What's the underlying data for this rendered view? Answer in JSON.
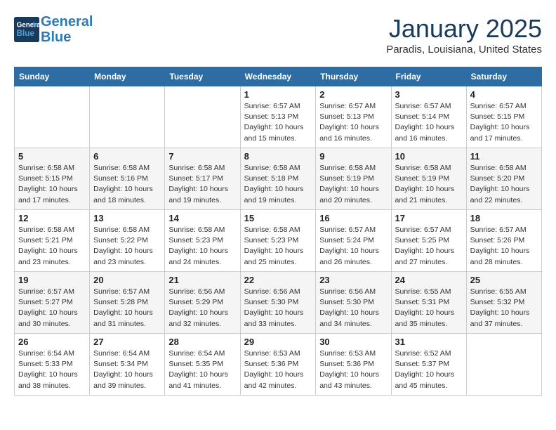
{
  "header": {
    "logo_line1": "General",
    "logo_line2": "Blue",
    "month": "January 2025",
    "location": "Paradis, Louisiana, United States"
  },
  "days_of_week": [
    "Sunday",
    "Monday",
    "Tuesday",
    "Wednesday",
    "Thursday",
    "Friday",
    "Saturday"
  ],
  "weeks": [
    [
      {
        "day": "",
        "detail": ""
      },
      {
        "day": "",
        "detail": ""
      },
      {
        "day": "",
        "detail": ""
      },
      {
        "day": "1",
        "detail": "Sunrise: 6:57 AM\nSunset: 5:13 PM\nDaylight: 10 hours\nand 15 minutes."
      },
      {
        "day": "2",
        "detail": "Sunrise: 6:57 AM\nSunset: 5:13 PM\nDaylight: 10 hours\nand 16 minutes."
      },
      {
        "day": "3",
        "detail": "Sunrise: 6:57 AM\nSunset: 5:14 PM\nDaylight: 10 hours\nand 16 minutes."
      },
      {
        "day": "4",
        "detail": "Sunrise: 6:57 AM\nSunset: 5:15 PM\nDaylight: 10 hours\nand 17 minutes."
      }
    ],
    [
      {
        "day": "5",
        "detail": "Sunrise: 6:58 AM\nSunset: 5:15 PM\nDaylight: 10 hours\nand 17 minutes."
      },
      {
        "day": "6",
        "detail": "Sunrise: 6:58 AM\nSunset: 5:16 PM\nDaylight: 10 hours\nand 18 minutes."
      },
      {
        "day": "7",
        "detail": "Sunrise: 6:58 AM\nSunset: 5:17 PM\nDaylight: 10 hours\nand 19 minutes."
      },
      {
        "day": "8",
        "detail": "Sunrise: 6:58 AM\nSunset: 5:18 PM\nDaylight: 10 hours\nand 19 minutes."
      },
      {
        "day": "9",
        "detail": "Sunrise: 6:58 AM\nSunset: 5:19 PM\nDaylight: 10 hours\nand 20 minutes."
      },
      {
        "day": "10",
        "detail": "Sunrise: 6:58 AM\nSunset: 5:19 PM\nDaylight: 10 hours\nand 21 minutes."
      },
      {
        "day": "11",
        "detail": "Sunrise: 6:58 AM\nSunset: 5:20 PM\nDaylight: 10 hours\nand 22 minutes."
      }
    ],
    [
      {
        "day": "12",
        "detail": "Sunrise: 6:58 AM\nSunset: 5:21 PM\nDaylight: 10 hours\nand 23 minutes."
      },
      {
        "day": "13",
        "detail": "Sunrise: 6:58 AM\nSunset: 5:22 PM\nDaylight: 10 hours\nand 23 minutes."
      },
      {
        "day": "14",
        "detail": "Sunrise: 6:58 AM\nSunset: 5:23 PM\nDaylight: 10 hours\nand 24 minutes."
      },
      {
        "day": "15",
        "detail": "Sunrise: 6:58 AM\nSunset: 5:23 PM\nDaylight: 10 hours\nand 25 minutes."
      },
      {
        "day": "16",
        "detail": "Sunrise: 6:57 AM\nSunset: 5:24 PM\nDaylight: 10 hours\nand 26 minutes."
      },
      {
        "day": "17",
        "detail": "Sunrise: 6:57 AM\nSunset: 5:25 PM\nDaylight: 10 hours\nand 27 minutes."
      },
      {
        "day": "18",
        "detail": "Sunrise: 6:57 AM\nSunset: 5:26 PM\nDaylight: 10 hours\nand 28 minutes."
      }
    ],
    [
      {
        "day": "19",
        "detail": "Sunrise: 6:57 AM\nSunset: 5:27 PM\nDaylight: 10 hours\nand 30 minutes."
      },
      {
        "day": "20",
        "detail": "Sunrise: 6:57 AM\nSunset: 5:28 PM\nDaylight: 10 hours\nand 31 minutes."
      },
      {
        "day": "21",
        "detail": "Sunrise: 6:56 AM\nSunset: 5:29 PM\nDaylight: 10 hours\nand 32 minutes."
      },
      {
        "day": "22",
        "detail": "Sunrise: 6:56 AM\nSunset: 5:30 PM\nDaylight: 10 hours\nand 33 minutes."
      },
      {
        "day": "23",
        "detail": "Sunrise: 6:56 AM\nSunset: 5:30 PM\nDaylight: 10 hours\nand 34 minutes."
      },
      {
        "day": "24",
        "detail": "Sunrise: 6:55 AM\nSunset: 5:31 PM\nDaylight: 10 hours\nand 35 minutes."
      },
      {
        "day": "25",
        "detail": "Sunrise: 6:55 AM\nSunset: 5:32 PM\nDaylight: 10 hours\nand 37 minutes."
      }
    ],
    [
      {
        "day": "26",
        "detail": "Sunrise: 6:54 AM\nSunset: 5:33 PM\nDaylight: 10 hours\nand 38 minutes."
      },
      {
        "day": "27",
        "detail": "Sunrise: 6:54 AM\nSunset: 5:34 PM\nDaylight: 10 hours\nand 39 minutes."
      },
      {
        "day": "28",
        "detail": "Sunrise: 6:54 AM\nSunset: 5:35 PM\nDaylight: 10 hours\nand 41 minutes."
      },
      {
        "day": "29",
        "detail": "Sunrise: 6:53 AM\nSunset: 5:36 PM\nDaylight: 10 hours\nand 42 minutes."
      },
      {
        "day": "30",
        "detail": "Sunrise: 6:53 AM\nSunset: 5:36 PM\nDaylight: 10 hours\nand 43 minutes."
      },
      {
        "day": "31",
        "detail": "Sunrise: 6:52 AM\nSunset: 5:37 PM\nDaylight: 10 hours\nand 45 minutes."
      },
      {
        "day": "",
        "detail": ""
      }
    ]
  ]
}
